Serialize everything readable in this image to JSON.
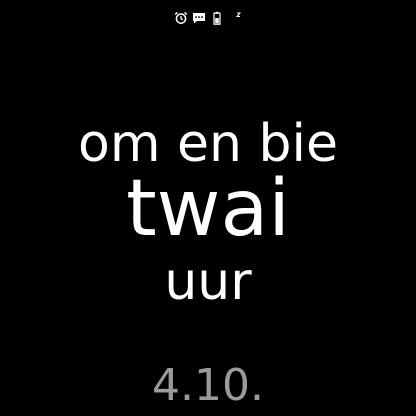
{
  "status_bar": {
    "icons": [
      "alarm-icon",
      "message-icon",
      "battery-icon",
      "sleep-mode-icon"
    ]
  },
  "clock": {
    "line_1": "om en bie",
    "line_2": "twai",
    "line_3": "uur"
  },
  "date": "4.10.",
  "colors": {
    "background": "#000000",
    "time_text": "#ffffff",
    "date_text": "#9a9a9a",
    "icons": "#ffffff"
  }
}
